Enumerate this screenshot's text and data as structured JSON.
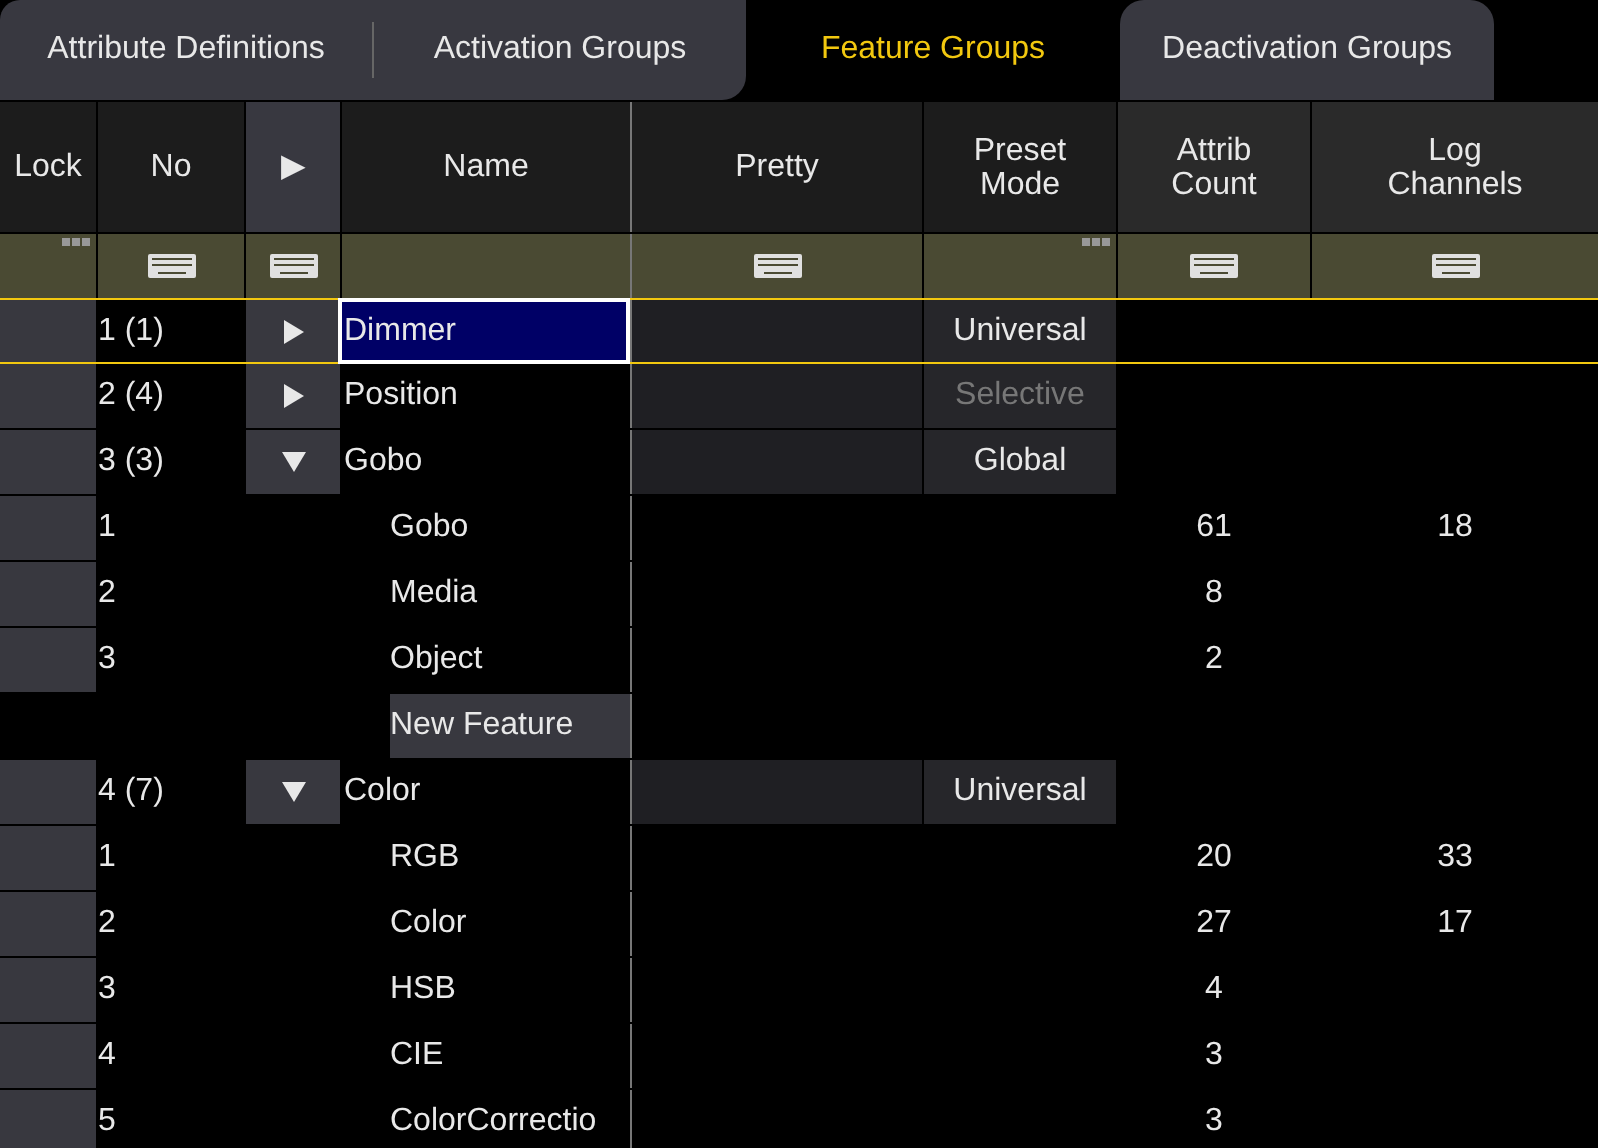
{
  "tabs": [
    {
      "label": "Attribute Definitions",
      "selected": false
    },
    {
      "label": "Activation Groups",
      "selected": false
    },
    {
      "label": "Feature Groups",
      "selected": true
    },
    {
      "label": "Deactivation Groups",
      "selected": false
    }
  ],
  "columns": [
    {
      "label": "Lock"
    },
    {
      "label": "No"
    },
    {
      "label": "▶"
    },
    {
      "label": "Name"
    },
    {
      "label": "Pretty"
    },
    {
      "label": "Preset Mode"
    },
    {
      "label": "Attrib Count"
    },
    {
      "label": "Log Channels"
    }
  ],
  "filter_row": [
    {
      "kind": "menu"
    },
    {
      "kind": "keyboard"
    },
    {
      "kind": "keyboard"
    },
    {
      "kind": "empty"
    },
    {
      "kind": "keyboard"
    },
    {
      "kind": "menu"
    },
    {
      "kind": "keyboard"
    },
    {
      "kind": "keyboard"
    }
  ],
  "rows": [
    {
      "kind": "group",
      "no": "1 (1)",
      "expanded": false,
      "name": "Dimmer",
      "preset_mode": "Universal",
      "preset_disabled": false,
      "selected": true
    },
    {
      "kind": "group",
      "no": "2 (4)",
      "expanded": false,
      "name": "Position",
      "preset_mode": "Selective",
      "preset_disabled": true,
      "selected": false
    },
    {
      "kind": "group",
      "no": "3 (3)",
      "expanded": true,
      "name": "Gobo",
      "preset_mode": "Global",
      "preset_disabled": false,
      "selected": false
    },
    {
      "kind": "feature",
      "no": "1",
      "name": "Gobo",
      "attrib_count": "61",
      "log_channels": "18",
      "selected": false
    },
    {
      "kind": "feature",
      "no": "2",
      "name": "Media",
      "attrib_count": "8",
      "selected": false
    },
    {
      "kind": "feature",
      "no": "3",
      "name": "Object",
      "attrib_count": "2",
      "selected": false
    },
    {
      "kind": "new",
      "name": "New Feature",
      "selected": false
    },
    {
      "kind": "group",
      "no": "4 (7)",
      "expanded": true,
      "name": "Color",
      "preset_mode": "Universal",
      "preset_disabled": false,
      "selected": false
    },
    {
      "kind": "feature",
      "no": "1",
      "name": "RGB",
      "attrib_count": "20",
      "log_channels": "33",
      "selected": false
    },
    {
      "kind": "feature",
      "no": "2",
      "name": "Color",
      "attrib_count": "27",
      "log_channels": "17",
      "selected": false
    },
    {
      "kind": "feature",
      "no": "3",
      "name": "HSB",
      "attrib_count": "4",
      "selected": false
    },
    {
      "kind": "feature",
      "no": "4",
      "name": "CIE",
      "attrib_count": "3",
      "selected": false
    },
    {
      "kind": "feature",
      "no": "5",
      "name": "ColorCorrectio",
      "attrib_count": "3",
      "selected": false
    }
  ]
}
